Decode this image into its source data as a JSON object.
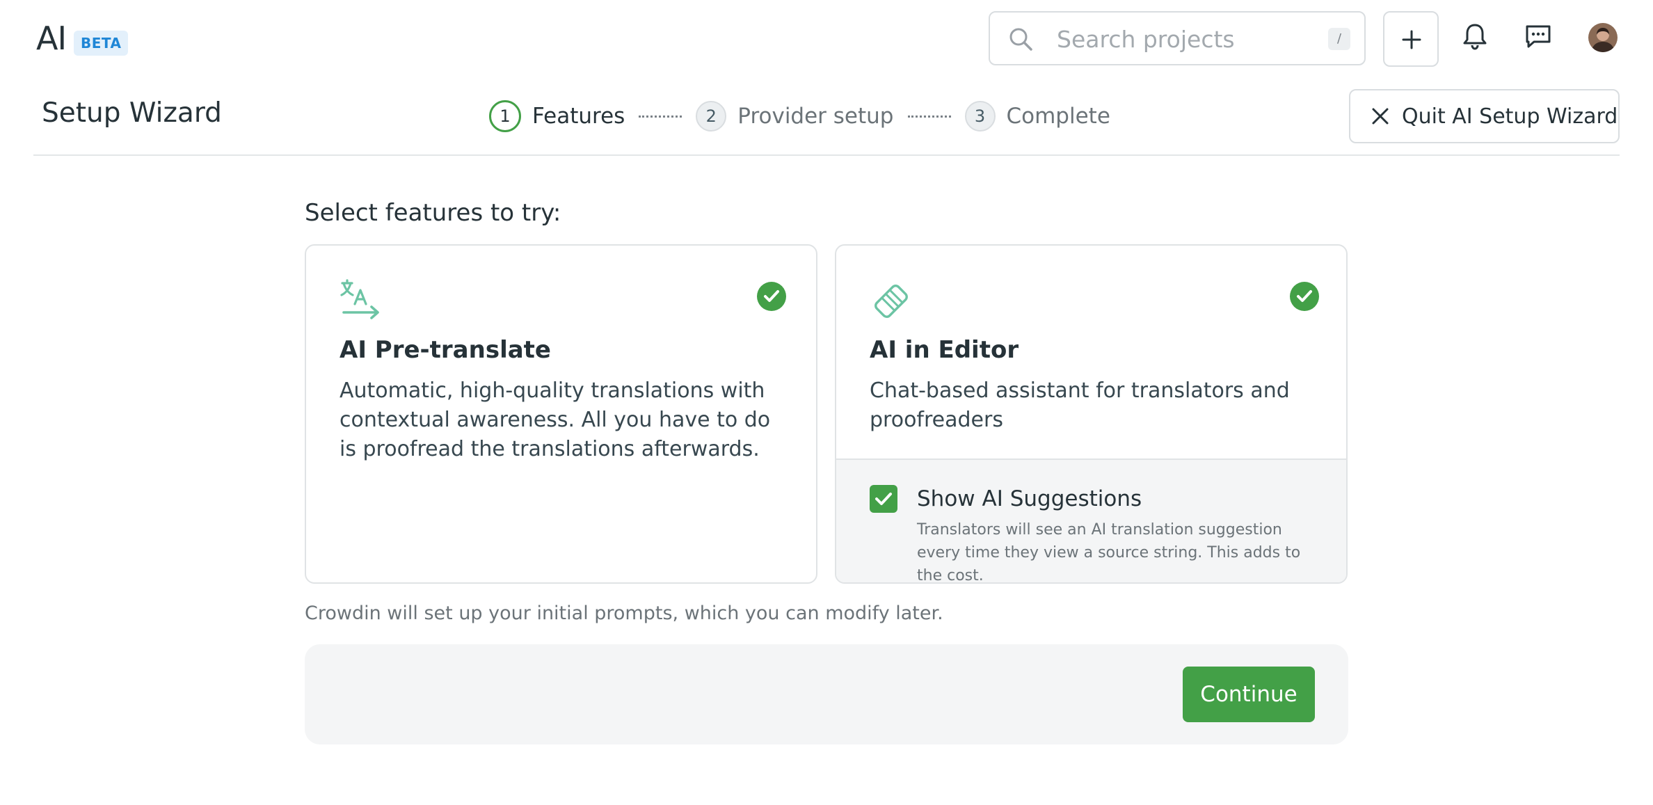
{
  "header": {
    "logo": "AI",
    "badge": "BETA",
    "search": {
      "placeholder": "Search projects",
      "shortcut": "/"
    },
    "icons": [
      "search-icon",
      "plus-icon",
      "bell-icon",
      "chat-icon",
      "avatar"
    ]
  },
  "wizard": {
    "title": "Setup Wizard",
    "steps": [
      {
        "number": "1",
        "label": "Features",
        "state": "active"
      },
      {
        "number": "2",
        "label": "Provider setup",
        "state": "pending"
      },
      {
        "number": "3",
        "label": "Complete",
        "state": "pending"
      }
    ],
    "quit_label": "Quit AI Setup Wizard"
  },
  "main": {
    "section_title": "Select features to try:",
    "cards": [
      {
        "icon": "translate-icon",
        "title": "AI Pre-translate",
        "description": "Automatic, high-quality translations with contextual awareness. All you have to do is proofread the translations afterwards.",
        "selected": true
      },
      {
        "icon": "handshake-icon",
        "title": "AI in Editor",
        "description": "Chat-based assistant for translators and proofreaders",
        "selected": true,
        "option": {
          "label": "Show AI Suggestions",
          "description": "Translators will see an AI translation suggestion every time they view a source string. This adds to the cost.",
          "checked": true
        }
      }
    ],
    "note": "Crowdin will set up your initial prompts, which you can modify later.",
    "continue_label": "Continue"
  },
  "colors": {
    "accent_green": "#43a047",
    "feature_icon": "#6cc4a4",
    "beta_blue": "#1f86d6"
  }
}
